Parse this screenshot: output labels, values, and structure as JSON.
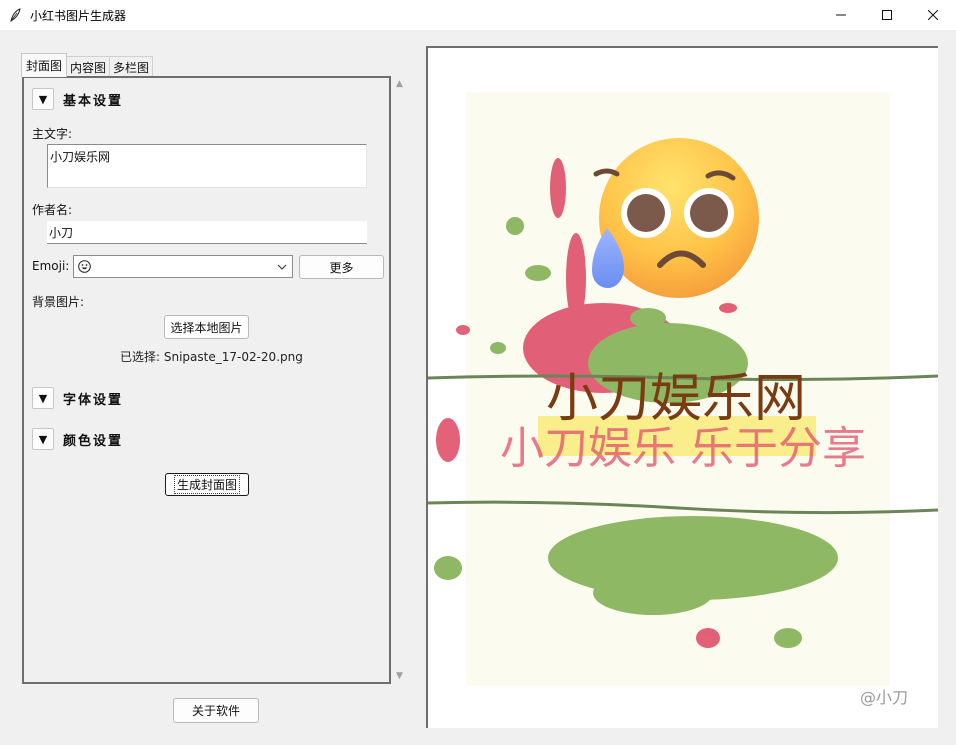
{
  "window": {
    "title": "小红书图片生成器"
  },
  "tabs": [
    {
      "label": "封面图",
      "active": true
    },
    {
      "label": "内容图",
      "active": false
    },
    {
      "label": "多栏图",
      "active": false
    }
  ],
  "sections": {
    "basic": {
      "toggle": "▼",
      "title": "基本设置"
    },
    "font": {
      "toggle": "▼",
      "title": "字体设置"
    },
    "color": {
      "toggle": "▼",
      "title": "颜色设置"
    }
  },
  "form": {
    "main_text_label": "主文字:",
    "main_text_value": "小刀娱乐网",
    "author_label": "作者名:",
    "author_value": "小刀",
    "emoji_label": "Emoji:",
    "emoji_icon": "grinning-face-icon",
    "more_button": "更多",
    "bg_label": "背景图片:",
    "choose_local_button": "选择本地图片",
    "selected_file": "已选择: Snipaste_17-02-20.png",
    "generate_button": "生成封面图"
  },
  "about_button": "关于软件",
  "preview": {
    "main_text": "小刀娱乐网",
    "background_text": "小刀娱乐 乐于分享",
    "author_mark": "@小刀",
    "emoji_icon": "anxious-face-with-sweat-icon",
    "colors": {
      "main_text": "#7a3b12",
      "highlight": "#f7e43a",
      "splash_pink": "#e0506a",
      "splash_green": "#8fb864",
      "paper": "#fcfbf0"
    }
  }
}
